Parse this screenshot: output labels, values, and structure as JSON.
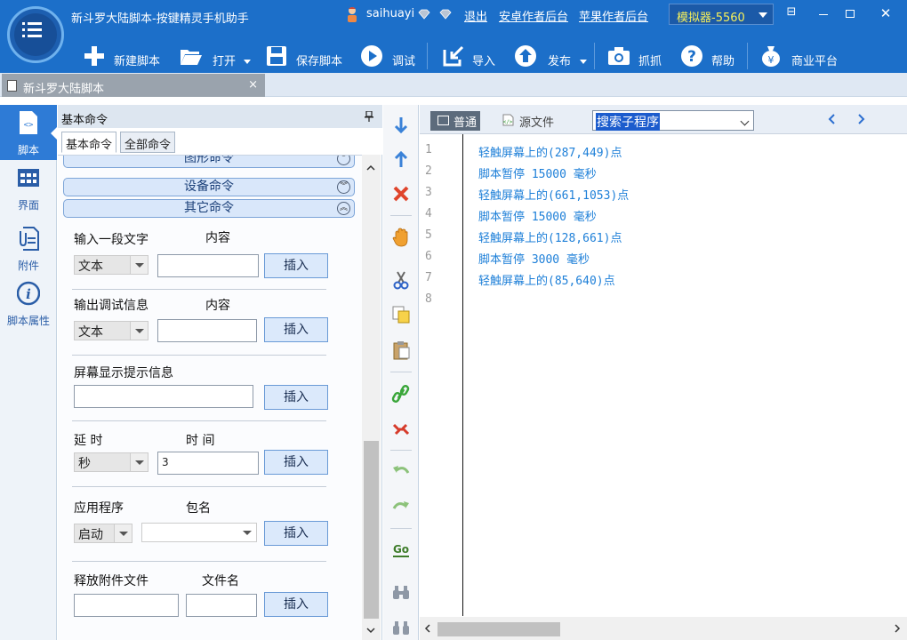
{
  "titlebar": {
    "title": "新斗罗大陆脚本-按键精灵手机助手",
    "username": "saihuayi",
    "logout": "退出",
    "android_backend": "安卓作者后台",
    "ios_backend": "苹果作者后台",
    "emulator": "模拟器-5560",
    "minimize_icon": "⊟",
    "maximize_icon": "☐",
    "close_icon": "✕"
  },
  "toolbar": {
    "new_script": "新建脚本",
    "open": "打开",
    "save_script": "保存脚本",
    "debug": "调试",
    "import": "导入",
    "publish": "发布",
    "capture": "抓抓",
    "help": "帮助",
    "business": "商业平台"
  },
  "doc_tab": {
    "name": "新斗罗大陆脚本",
    "close": "×"
  },
  "sidebar": {
    "items": [
      {
        "label": "脚本"
      },
      {
        "label": "界面"
      },
      {
        "label": "附件"
      },
      {
        "label": "脚本属性"
      }
    ]
  },
  "commands": {
    "header": "基本命令",
    "tabs": [
      "基本命令",
      "全部命令"
    ],
    "groups": [
      "图形命令",
      "设备命令",
      "其它命令"
    ],
    "insert": "插入",
    "input_text": {
      "label": "输入一段文字",
      "content_label": "内容",
      "type": "文本",
      "value": ""
    },
    "debug_output": {
      "label": "输出调试信息",
      "content_label": "内容",
      "type": "文本",
      "value": ""
    },
    "screen_tip": {
      "label": "屏幕显示提示信息",
      "value": ""
    },
    "delay": {
      "label": "延 时",
      "time_label": "时 间",
      "unit": "秒",
      "value": "3"
    },
    "app": {
      "label": "应用程序",
      "pkg_label": "包名",
      "action": "启动",
      "value": ""
    },
    "release_file": {
      "label": "释放附件文件",
      "file_label": "文件名",
      "value1": "",
      "value2": ""
    }
  },
  "editor": {
    "mode_normal": "普通",
    "mode_source": "源文件",
    "sub_search": "搜索子程序",
    "lines": [
      {
        "no": "1",
        "code": "轻触屏幕上的(287,449)点"
      },
      {
        "no": "2",
        "code": "脚本暂停 15000 毫秒"
      },
      {
        "no": "3",
        "code": "轻触屏幕上的(661,1053)点"
      },
      {
        "no": "4",
        "code": "脚本暂停 15000 毫秒"
      },
      {
        "no": "5",
        "code": "轻触屏幕上的(128,661)点"
      },
      {
        "no": "6",
        "code": "脚本暂停 3000 毫秒"
      },
      {
        "no": "7",
        "code": "轻触屏幕上的(85,640)点"
      },
      {
        "no": "8",
        "code": ""
      }
    ]
  },
  "colors": {
    "titlebar": "#1c6fc9",
    "emulator_text": "#f6ef5a",
    "code_text": "#1d7fd8",
    "sidebar_active": "#2e7bd6"
  }
}
